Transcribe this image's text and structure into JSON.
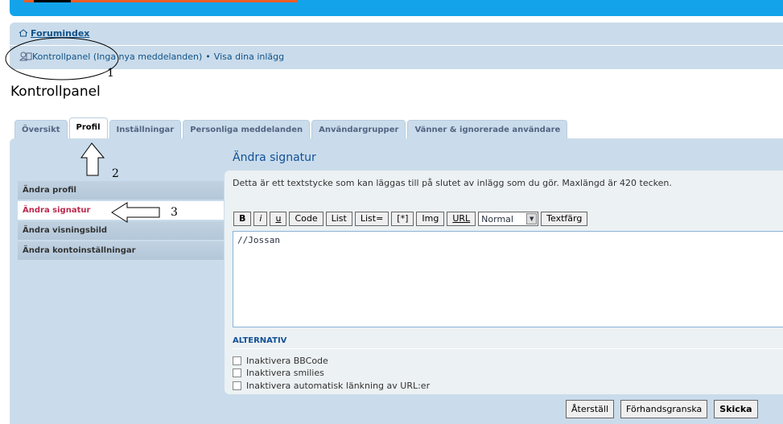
{
  "breadcrumb": {
    "home": "Forumindex"
  },
  "navline": {
    "control_panel": "Kontrollpanel",
    "no_messages": "(Inga nya meddelanden)",
    "separator": "•",
    "view_posts": "Visa dina inlägg"
  },
  "page_title": "Kontrollpanel",
  "tabs": [
    {
      "label": "Översikt"
    },
    {
      "label": "Profil"
    },
    {
      "label": "Inställningar"
    },
    {
      "label": "Personliga meddelanden"
    },
    {
      "label": "Användargrupper"
    },
    {
      "label": "Vänner & ignorerade användare"
    }
  ],
  "sidebar": {
    "items": [
      {
        "label": "Ändra profil"
      },
      {
        "label": "Ändra signatur"
      },
      {
        "label": "Ändra visningsbild"
      },
      {
        "label": "Ändra kontoinställningar"
      }
    ]
  },
  "main": {
    "title": "Ändra signatur",
    "description": "Detta är ett textstycke som kan läggas till på slutet av inlägg som du gör. Maxlängd är 420 tecken.",
    "toolbar": {
      "bold": "B",
      "italic": "i",
      "underline": "u",
      "code": "Code",
      "list": "List",
      "list_ordered": "List=",
      "list_item": "[*]",
      "img": "Img",
      "url": "URL",
      "font_size": "Normal",
      "text_color": "Textfärg"
    },
    "signature_text": "//Jossan",
    "options_title": "ALTERNATIV",
    "options": [
      {
        "label": "Inaktivera BBCode"
      },
      {
        "label": "Inaktivera smilies"
      },
      {
        "label": "Inaktivera automatisk länkning av URL:er"
      }
    ],
    "buttons": {
      "reset": "Återställ",
      "preview": "Förhandsgranska",
      "submit": "Skicka"
    }
  },
  "annotations": {
    "n1": "1",
    "n2": "2",
    "n3": "3"
  },
  "colors": {
    "header_blue": "#12A3EB",
    "nav_bg": "#CADCEB",
    "active_side": "#BC2A4D",
    "link": "#105289"
  }
}
